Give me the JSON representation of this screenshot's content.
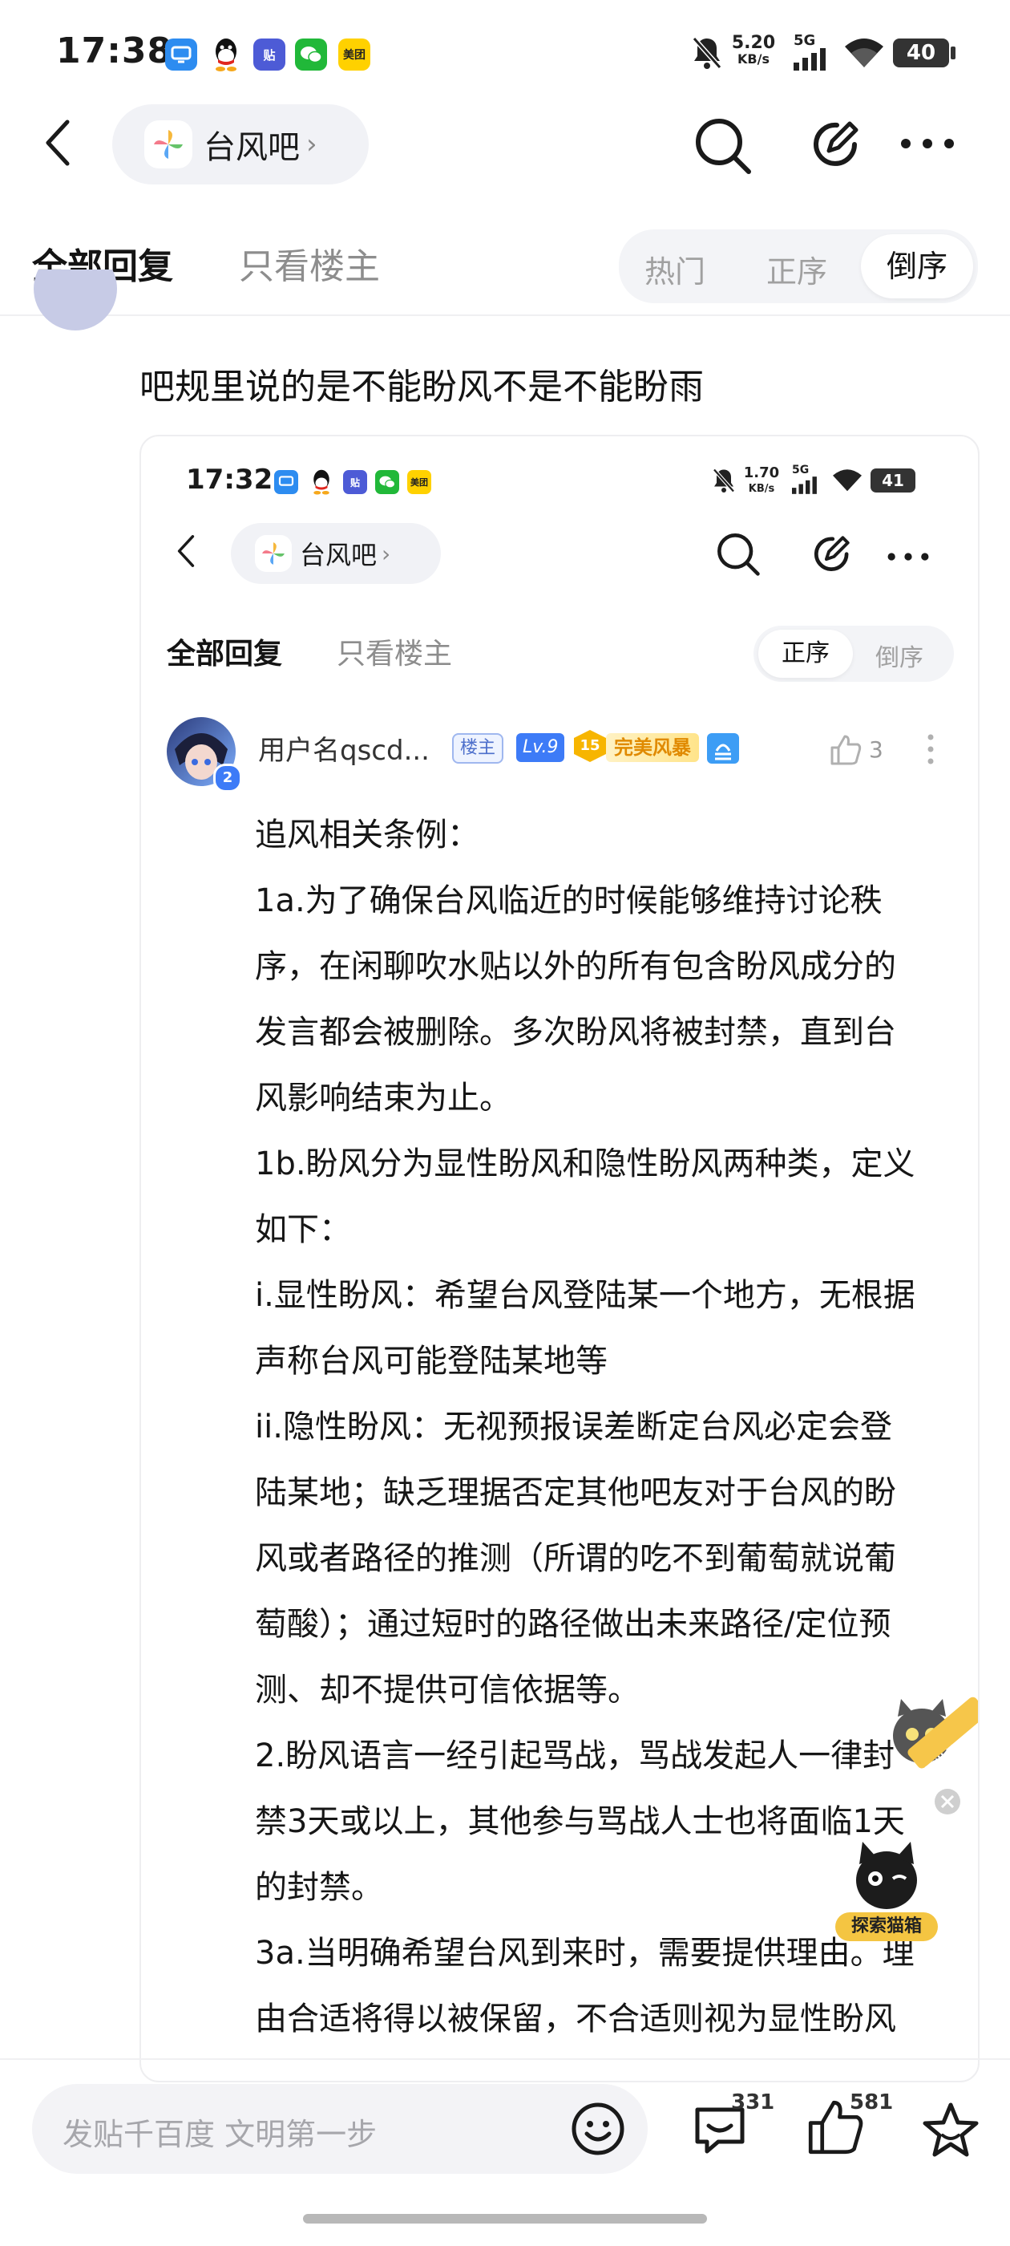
{
  "status_bar": {
    "time": "17:38",
    "net_speed": "5.20",
    "net_unit": "KB/s",
    "network": "5G",
    "battery": "40",
    "app_icons": [
      "taskbar-app-icon",
      "qq-icon",
      "tieba-icon",
      "wechat-icon",
      "meituan-icon"
    ],
    "meituan_label": "美团",
    "tieba_label": "贴"
  },
  "header": {
    "forum_name": "台风吧"
  },
  "tabs": {
    "all_replies": "全部回复",
    "op_only": "只看楼主",
    "sort": [
      "热门",
      "正序",
      "倒序"
    ],
    "sort_selected": "倒序"
  },
  "reply": {
    "text": "吧规里说的是不能盼风不是不能盼雨"
  },
  "embedded": {
    "status_bar": {
      "time": "17:32",
      "net_speed": "1.70",
      "net_unit": "KB/s",
      "network": "5G",
      "battery": "41",
      "meituan_label": "美团",
      "tieba_label": "贴"
    },
    "header": {
      "forum_name": "台风吧"
    },
    "tabs": {
      "all_replies": "全部回复",
      "op_only": "只看楼主",
      "sort": [
        "正序",
        "倒序"
      ],
      "sort_selected": "正序"
    },
    "post": {
      "username": "用户名qscd...",
      "avatar_badge": "2",
      "op_badge": "楼主",
      "level": "Lv.9",
      "honor_level": "15",
      "honor_title": "完美风暴",
      "like_count": "3",
      "lines": [
        "追风相关条例：",
        "1a.为了确保台风临近的时候能够维持讨论秩",
        "序，在闲聊吹水贴以外的所有包含盼风成分的",
        "发言都会被删除。多次盼风将被封禁，直到台",
        "风影响结束为止。",
        "1b.盼风分为显性盼风和隐性盼风两种类，定义",
        "如下：",
        "i.显性盼风：希望台风登陆某一个地方，无根据",
        "声称台风可能登陆某地等",
        "ii.隐性盼风：无视预报误差断定台风必定会登",
        "陆某地；缺乏理据否定其他吧友对于台风的盼",
        "风或者路径的推测（所谓的吃不到葡萄就说葡",
        "萄酸）；通过短时的路径做出未来路径/定位预",
        "测、却不提供可信依据等。",
        "2.盼风语言一经引起骂战，骂战发起人一律封",
        "禁3天或以上，其他参与骂战人士也将面临1天",
        "的封禁。",
        "3a.当明确希望台风到来时，需要提供理由。理",
        "由合适将得以被保留，不合适则视为显性盼风"
      ]
    },
    "floating_badge": {
      "label": "探索猫箱",
      "ribbon": "探索猫箱"
    }
  },
  "bottom_bar": {
    "input_placeholder": "发贴千百度 文明第一步",
    "comment_count": "331",
    "like_count": "581"
  },
  "colors": {
    "accent_blue": "#3d7bf7",
    "text": "#141414",
    "muted": "#9a9a9a"
  }
}
